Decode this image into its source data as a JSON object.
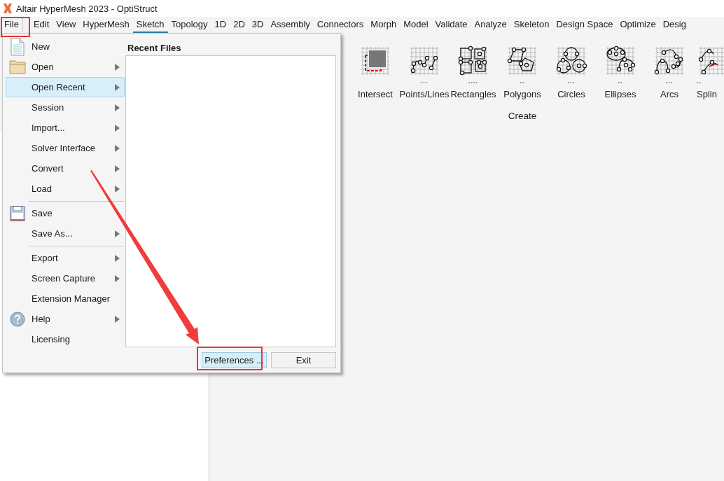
{
  "window": {
    "title": "Altair HyperMesh 2023 - OptiStruct"
  },
  "menubar": [
    {
      "label": "File",
      "selected": false,
      "open": true
    },
    {
      "label": "Edit",
      "selected": false,
      "open": false
    },
    {
      "label": "View",
      "selected": false,
      "open": false
    },
    {
      "label": "HyperMesh",
      "selected": false,
      "open": false
    },
    {
      "label": "Sketch",
      "selected": true,
      "open": false
    },
    {
      "label": "Topology",
      "selected": false,
      "open": false
    },
    {
      "label": "1D",
      "selected": false,
      "open": false
    },
    {
      "label": "2D",
      "selected": false,
      "open": false
    },
    {
      "label": "3D",
      "selected": false,
      "open": false
    },
    {
      "label": "Assembly",
      "selected": false,
      "open": false
    },
    {
      "label": "Connectors",
      "selected": false,
      "open": false
    },
    {
      "label": "Morph",
      "selected": false,
      "open": false
    },
    {
      "label": "Model",
      "selected": false,
      "open": false
    },
    {
      "label": "Validate",
      "selected": false,
      "open": false
    },
    {
      "label": "Analyze",
      "selected": false,
      "open": false
    },
    {
      "label": "Skeleton",
      "selected": false,
      "open": false
    },
    {
      "label": "Design Space",
      "selected": false,
      "open": false
    },
    {
      "label": "Optimize",
      "selected": false,
      "open": false
    },
    {
      "label": "Desig",
      "selected": false,
      "open": false
    }
  ],
  "ribbon": {
    "tools": [
      {
        "kind": "intersect",
        "label": "Intersect"
      },
      {
        "kind": "points",
        "label": "Points/Lines",
        "dots": "•••"
      },
      {
        "kind": "rectangles",
        "label": "Rectangles",
        "dots": "••••"
      },
      {
        "kind": "polygons",
        "label": "Polygons",
        "dots": "••"
      },
      {
        "kind": "circles",
        "label": "Circles",
        "dots": "•••"
      },
      {
        "kind": "ellipses",
        "label": "Ellipses",
        "dots": "••"
      },
      {
        "kind": "arcs",
        "label": "Arcs",
        "dots": "•••"
      },
      {
        "kind": "spline",
        "label": "Splin",
        "dots": "••"
      }
    ],
    "group_label": "Create"
  },
  "file_menu": {
    "items": [
      {
        "label": "New",
        "submenu": false,
        "selected": false,
        "separator_before": false
      },
      {
        "label": "Open",
        "submenu": true,
        "selected": false,
        "separator_before": false
      },
      {
        "label": "Open Recent",
        "submenu": true,
        "selected": true,
        "separator_before": false
      },
      {
        "label": "Session",
        "submenu": true,
        "selected": false,
        "separator_before": false
      },
      {
        "label": "Import...",
        "submenu": true,
        "selected": false,
        "separator_before": false
      },
      {
        "label": "Solver Interface",
        "submenu": true,
        "selected": false,
        "separator_before": false
      },
      {
        "label": "Convert",
        "submenu": true,
        "selected": false,
        "separator_before": false
      },
      {
        "label": "Load",
        "submenu": true,
        "selected": false,
        "separator_before": false
      },
      {
        "label": "Save",
        "submenu": false,
        "selected": false,
        "separator_before": true
      },
      {
        "label": "Save As...",
        "submenu": true,
        "selected": false,
        "separator_before": false
      },
      {
        "label": "Export",
        "submenu": true,
        "selected": false,
        "separator_before": true
      },
      {
        "label": "Screen Capture",
        "submenu": true,
        "selected": false,
        "separator_before": false
      },
      {
        "label": "Extension Manager",
        "submenu": false,
        "selected": false,
        "separator_before": false
      },
      {
        "label": "Help",
        "submenu": true,
        "selected": false,
        "separator_before": false
      },
      {
        "label": "Licensing",
        "submenu": false,
        "selected": false,
        "separator_before": false
      }
    ],
    "recent_files_title": "Recent Files",
    "buttons": [
      {
        "label": "Preferences ...",
        "highlighted": true
      },
      {
        "label": "Exit",
        "highlighted": false
      }
    ]
  }
}
